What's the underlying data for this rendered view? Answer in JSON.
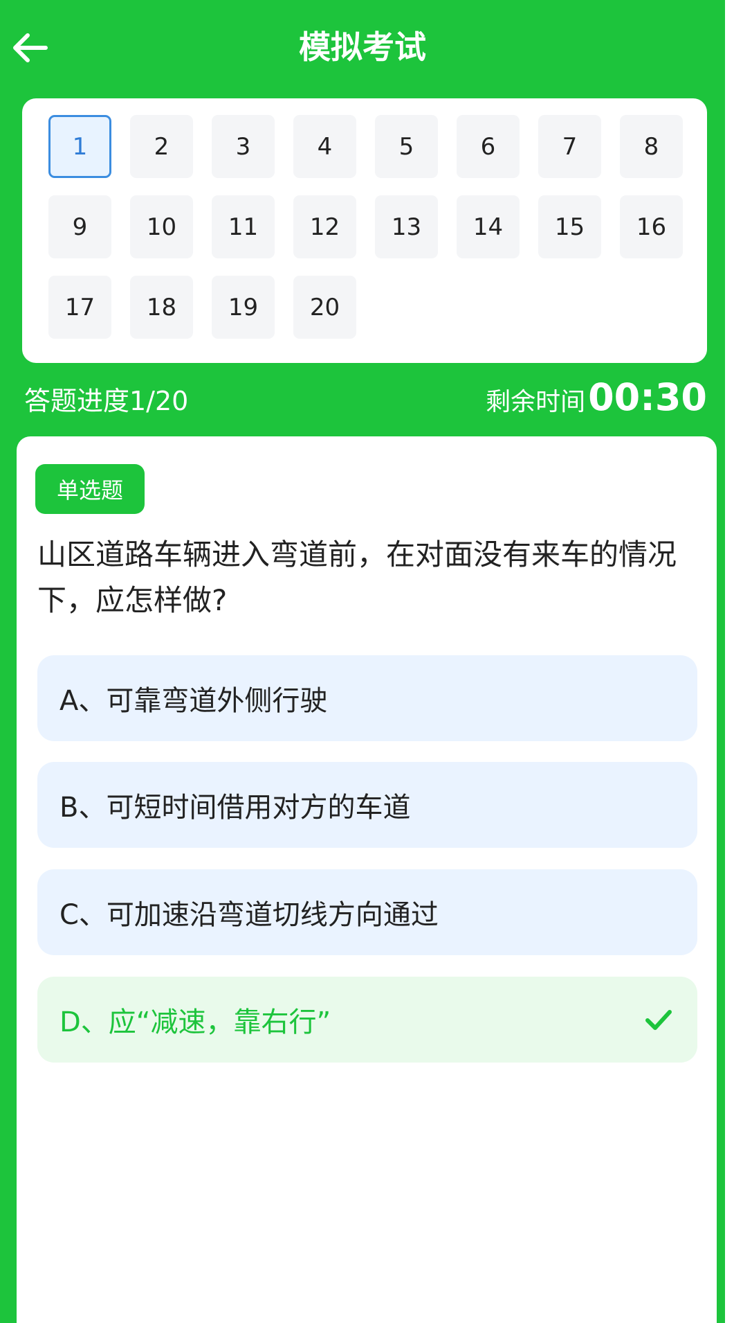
{
  "header": {
    "title": "模拟考试",
    "back_icon": "arrow-left-icon"
  },
  "question_nav": {
    "current": "1",
    "numbers": [
      "1",
      "2",
      "3",
      "4",
      "5",
      "6",
      "7",
      "8",
      "9",
      "10",
      "11",
      "12",
      "13",
      "14",
      "15",
      "16",
      "17",
      "18",
      "19",
      "20"
    ]
  },
  "status": {
    "progress_label": "答题进度1/20",
    "timer_label": "剩余时间",
    "timer_value": "00:30"
  },
  "question": {
    "type_badge": "单选题",
    "text": "山区道路车辆进入弯道前，在对面没有来车的情况下，应怎样做?",
    "options": [
      {
        "label": "A、可靠弯道外侧行驶",
        "state": "default"
      },
      {
        "label": "B、可短时间借用对方的车道",
        "state": "default"
      },
      {
        "label": "C、可加速沿弯道切线方向通过",
        "state": "default"
      },
      {
        "label": "D、应“减速，靠右行”",
        "state": "correct",
        "icon": "checkmark-icon"
      }
    ]
  },
  "colors": {
    "brand_green": "#1DC43C",
    "current_border": "#3B8DE0",
    "option_bg": "#EAF3FF",
    "correct_bg": "#E9FAEB"
  }
}
